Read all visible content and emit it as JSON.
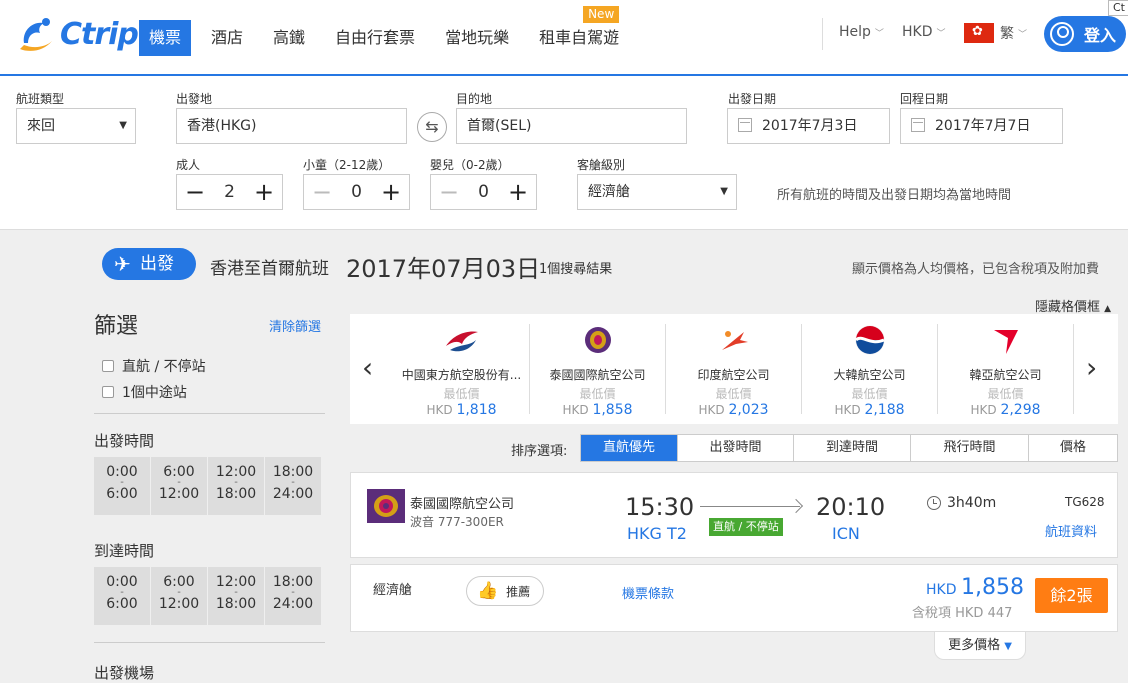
{
  "header": {
    "brand": "Ctrip",
    "nav": [
      {
        "label": "機票",
        "active": true
      },
      {
        "label": "酒店",
        "active": false
      },
      {
        "label": "高鐵",
        "active": false
      },
      {
        "label": "自由行套票",
        "active": false
      },
      {
        "label": "當地玩樂",
        "active": false
      },
      {
        "label": "租車自駕遊",
        "active": false,
        "badge": "New"
      }
    ],
    "help": "Help",
    "currency": "HKD",
    "language": "繁",
    "login": "登入",
    "tab_fragment": "Ct"
  },
  "search": {
    "trip_type_label": "航班類型",
    "trip_type": "來回",
    "from_label": "出發地",
    "from": "香港(HKG)",
    "to_label": "目的地",
    "to": "首爾(SEL)",
    "depart_label": "出發日期",
    "depart": "2017年7月3日",
    "return_label": "回程日期",
    "return": "2017年7月7日",
    "adult_label": "成人",
    "adult": "2",
    "child_label": "小童（2-12歲）",
    "child": "0",
    "infant_label": "嬰兒（0-2歲）",
    "infant": "0",
    "cabin_label": "客艙級別",
    "cabin": "經濟艙",
    "local_time_note": "所有航班的時間及出發日期均為當地時間"
  },
  "results": {
    "depart_pill": "出發",
    "route": "香港至首爾航班",
    "date": "2017年07月03日",
    "count": "1個搜尋結果",
    "price_note": "顯示價格為人均價格，已包含稅項及附加費",
    "hide_price": "隱藏格價框"
  },
  "filter": {
    "title": "篩選",
    "clear": "清除篩選",
    "stops": [
      "直航 / 不停站",
      "1個中途站"
    ],
    "dep_time_title": "出發時間",
    "arr_time_title": "到達時間",
    "airport_title": "出發機場",
    "slots": [
      {
        "from": "0:00",
        "to": "6:00"
      },
      {
        "from": "6:00",
        "to": "12:00"
      },
      {
        "from": "12:00",
        "to": "18:00"
      },
      {
        "from": "18:00",
        "to": "24:00"
      }
    ]
  },
  "airlines": [
    {
      "name": "中國東方航空股份有...",
      "low_label": "最低價",
      "currency": "HKD",
      "price": "1,818",
      "logo": "china-eastern-logo-icon"
    },
    {
      "name": "泰國國際航空公司",
      "low_label": "最低價",
      "currency": "HKD",
      "price": "1,858",
      "logo": "thai-airways-logo-icon"
    },
    {
      "name": "印度航空公司",
      "low_label": "最低價",
      "currency": "HKD",
      "price": "2,023",
      "logo": "air-india-logo-icon"
    },
    {
      "name": "大韓航空公司",
      "low_label": "最低價",
      "currency": "HKD",
      "price": "2,188",
      "logo": "korean-air-logo-icon"
    },
    {
      "name": "韓亞航空公司",
      "low_label": "最低價",
      "currency": "HKD",
      "price": "2,298",
      "logo": "asiana-logo-icon"
    }
  ],
  "sort": {
    "label": "排序選項:",
    "options": [
      "直航優先",
      "出發時間",
      "到達時間",
      "飛行時間",
      "價格"
    ]
  },
  "flight": {
    "airline": "泰國國際航空公司",
    "aircraft": "波音 777-300ER",
    "dep_time": "15:30",
    "dep_airport": "HKG T2",
    "direct": "直航 / 不停站",
    "arr_time": "20:10",
    "arr_airport": "ICN",
    "duration": "3h40m",
    "flight_no": "TG628",
    "detail": "航班資料"
  },
  "fare": {
    "cabin": "經濟艙",
    "recommend": "推薦",
    "rules": "機票條款",
    "currency": "HKD",
    "price": "1,858",
    "tax": "含稅項 HKD 447",
    "book": "餘2張",
    "more": "更多價格"
  },
  "colors": {
    "primary": "#2577e3",
    "orange": "#ff7d13",
    "green": "#48a832",
    "badge": "#f5a623"
  }
}
